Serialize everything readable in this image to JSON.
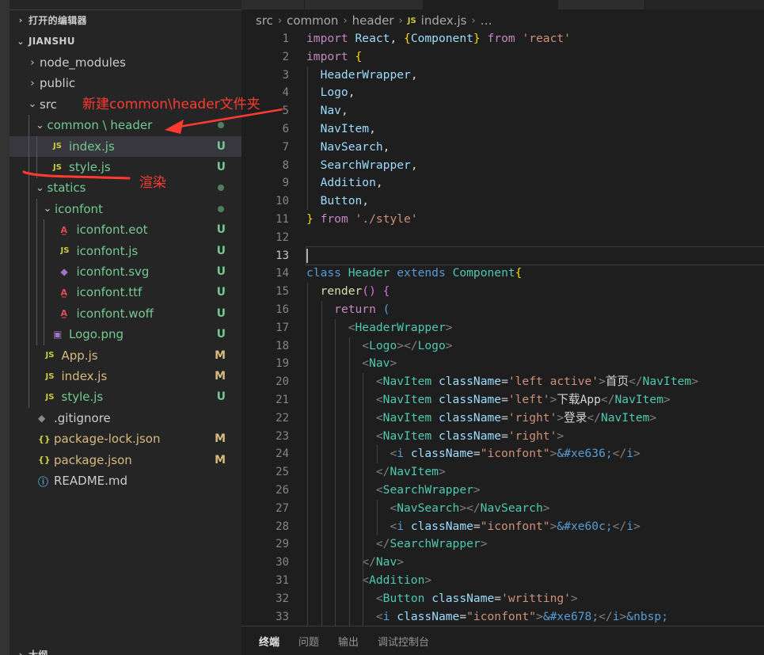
{
  "sidebar": {
    "open_editors_title": "打开的编辑器",
    "project_title": "JIANSHU",
    "outline_title": "大纲",
    "tree": [
      {
        "name": "node_modules",
        "depth": 0,
        "chevron": "›",
        "icon": "",
        "status": ""
      },
      {
        "name": "public",
        "depth": 0,
        "chevron": "›",
        "icon": "",
        "status": ""
      },
      {
        "name": "src",
        "depth": 0,
        "chevron": "⌄",
        "icon": "",
        "status": ""
      },
      {
        "name": "common \\ header",
        "depth": 1,
        "chevron": "⌄",
        "icon": "",
        "status": "dot"
      },
      {
        "name": "index.js",
        "depth": 2,
        "chevron": "",
        "icon": "JS",
        "status": "U",
        "selected": true
      },
      {
        "name": "style.js",
        "depth": 2,
        "chevron": "",
        "icon": "JS",
        "status": "U"
      },
      {
        "name": "statics",
        "depth": 1,
        "chevron": "⌄",
        "icon": "",
        "status": "dot"
      },
      {
        "name": "iconfont",
        "depth": 2,
        "chevron": "⌄",
        "icon": "",
        "status": "dot"
      },
      {
        "name": "iconfont.eot",
        "depth": 3,
        "chevron": "",
        "icon": "A",
        "status": "U"
      },
      {
        "name": "iconfont.js",
        "depth": 3,
        "chevron": "",
        "icon": "JS",
        "status": "U"
      },
      {
        "name": "iconfont.svg",
        "depth": 3,
        "chevron": "",
        "icon": "svg",
        "status": "U"
      },
      {
        "name": "iconfont.ttf",
        "depth": 3,
        "chevron": "",
        "icon": "A",
        "status": "U"
      },
      {
        "name": "iconfont.woff",
        "depth": 3,
        "chevron": "",
        "icon": "A",
        "status": "U"
      },
      {
        "name": "Logo.png",
        "depth": 2,
        "chevron": "",
        "icon": "img",
        "status": "U"
      },
      {
        "name": "App.js",
        "depth": 1,
        "chevron": "",
        "icon": "JS",
        "status": "M"
      },
      {
        "name": "index.js",
        "depth": 1,
        "chevron": "",
        "icon": "JS",
        "status": "M"
      },
      {
        "name": "style.js",
        "depth": 1,
        "chevron": "",
        "icon": "JS",
        "status": "U"
      },
      {
        "name": ".gitignore",
        "depth": 0,
        "chevron": "",
        "icon": "git",
        "status": ""
      },
      {
        "name": "package-lock.json",
        "depth": 0,
        "chevron": "",
        "icon": "{}",
        "status": "M"
      },
      {
        "name": "package.json",
        "depth": 0,
        "chevron": "",
        "icon": "{}",
        "status": "M"
      },
      {
        "name": "README.md",
        "depth": 0,
        "chevron": "",
        "icon": "info",
        "status": ""
      }
    ]
  },
  "editor": {
    "breadcrumb": [
      "src",
      "common",
      "header",
      "index.js",
      "…"
    ],
    "current_line": 13,
    "lines": [
      [
        [
          "kw",
          "import"
        ],
        [
          "tx",
          " "
        ],
        [
          "var",
          "React"
        ],
        [
          "tx",
          ", "
        ],
        [
          "br1",
          "{"
        ],
        [
          "var",
          "Component"
        ],
        [
          "br1",
          "}"
        ],
        [
          "tx",
          " "
        ],
        [
          "kw",
          "from"
        ],
        [
          "tx",
          " "
        ],
        [
          "str",
          "'react'"
        ]
      ],
      [
        [
          "kw",
          "import"
        ],
        [
          "tx",
          " "
        ],
        [
          "br1",
          "{"
        ]
      ],
      [
        [
          "tx",
          "  "
        ],
        [
          "var",
          "HeaderWrapper"
        ],
        [
          "tx",
          ","
        ]
      ],
      [
        [
          "tx",
          "  "
        ],
        [
          "var",
          "Logo"
        ],
        [
          "tx",
          ","
        ]
      ],
      [
        [
          "tx",
          "  "
        ],
        [
          "var",
          "Nav"
        ],
        [
          "tx",
          ","
        ]
      ],
      [
        [
          "tx",
          "  "
        ],
        [
          "var",
          "NavItem"
        ],
        [
          "tx",
          ","
        ]
      ],
      [
        [
          "tx",
          "  "
        ],
        [
          "var",
          "NavSearch"
        ],
        [
          "tx",
          ","
        ]
      ],
      [
        [
          "tx",
          "  "
        ],
        [
          "var",
          "SearchWrapper"
        ],
        [
          "tx",
          ","
        ]
      ],
      [
        [
          "tx",
          "  "
        ],
        [
          "var",
          "Addition"
        ],
        [
          "tx",
          ","
        ]
      ],
      [
        [
          "tx",
          "  "
        ],
        [
          "var",
          "Button"
        ],
        [
          "tx",
          ","
        ]
      ],
      [
        [
          "br1",
          "}"
        ],
        [
          "tx",
          " "
        ],
        [
          "kw",
          "from"
        ],
        [
          "tx",
          " "
        ],
        [
          "str",
          "'./style'"
        ]
      ],
      [],
      [],
      [
        [
          "kb",
          "class"
        ],
        [
          "tx",
          " "
        ],
        [
          "cls",
          "Header"
        ],
        [
          "tx",
          " "
        ],
        [
          "kb",
          "extends"
        ],
        [
          "tx",
          " "
        ],
        [
          "cls",
          "Component"
        ],
        [
          "br1",
          "{"
        ]
      ],
      [
        [
          "tx",
          "  "
        ],
        [
          "fn",
          "render"
        ],
        [
          "br2",
          "()"
        ],
        [
          "tx",
          " "
        ],
        [
          "br2",
          "{"
        ]
      ],
      [
        [
          "tx",
          "    "
        ],
        [
          "kw",
          "return"
        ],
        [
          "tx",
          " "
        ],
        [
          "kb",
          "("
        ]
      ],
      [
        [
          "tx",
          "      "
        ],
        [
          "tg",
          "<"
        ],
        [
          "tn",
          "HeaderWrapper"
        ],
        [
          "tg",
          ">"
        ]
      ],
      [
        [
          "tx",
          "        "
        ],
        [
          "tg",
          "<"
        ],
        [
          "tn",
          "Logo"
        ],
        [
          "tg",
          "></"
        ],
        [
          "tn",
          "Logo"
        ],
        [
          "tg",
          ">"
        ]
      ],
      [
        [
          "tx",
          "        "
        ],
        [
          "tg",
          "<"
        ],
        [
          "tn",
          "Nav"
        ],
        [
          "tg",
          ">"
        ]
      ],
      [
        [
          "tx",
          "          "
        ],
        [
          "tg",
          "<"
        ],
        [
          "tn",
          "NavItem"
        ],
        [
          "tx",
          " "
        ],
        [
          "at",
          "className"
        ],
        [
          "tx",
          "="
        ],
        [
          "str",
          "'left active'"
        ],
        [
          "tg",
          ">"
        ],
        [
          "tx",
          "首页"
        ],
        [
          "tg",
          "</"
        ],
        [
          "tn",
          "NavItem"
        ],
        [
          "tg",
          ">"
        ]
      ],
      [
        [
          "tx",
          "          "
        ],
        [
          "tg",
          "<"
        ],
        [
          "tn",
          "NavItem"
        ],
        [
          "tx",
          " "
        ],
        [
          "at",
          "className"
        ],
        [
          "tx",
          "="
        ],
        [
          "str",
          "'left'"
        ],
        [
          "tg",
          ">"
        ],
        [
          "tx",
          "下载App"
        ],
        [
          "tg",
          "</"
        ],
        [
          "tn",
          "NavItem"
        ],
        [
          "tg",
          ">"
        ]
      ],
      [
        [
          "tx",
          "          "
        ],
        [
          "tg",
          "<"
        ],
        [
          "tn",
          "NavItem"
        ],
        [
          "tx",
          " "
        ],
        [
          "at",
          "className"
        ],
        [
          "tx",
          "="
        ],
        [
          "str",
          "'right'"
        ],
        [
          "tg",
          ">"
        ],
        [
          "tx",
          "登录"
        ],
        [
          "tg",
          "</"
        ],
        [
          "tn",
          "NavItem"
        ],
        [
          "tg",
          ">"
        ]
      ],
      [
        [
          "tx",
          "          "
        ],
        [
          "tg",
          "<"
        ],
        [
          "tn",
          "NavItem"
        ],
        [
          "tx",
          " "
        ],
        [
          "at",
          "className"
        ],
        [
          "tx",
          "="
        ],
        [
          "str",
          "'right'"
        ],
        [
          "tg",
          ">"
        ]
      ],
      [
        [
          "tx",
          "            "
        ],
        [
          "tg",
          "<"
        ],
        [
          "kb",
          "i"
        ],
        [
          "tx",
          " "
        ],
        [
          "at",
          "className"
        ],
        [
          "tx",
          "="
        ],
        [
          "str",
          "\"iconfont\""
        ],
        [
          "tg",
          ">"
        ],
        [
          "kb",
          "&#xe636;"
        ],
        [
          "tg",
          "</"
        ],
        [
          "kb",
          "i"
        ],
        [
          "tg",
          ">"
        ]
      ],
      [
        [
          "tx",
          "          "
        ],
        [
          "tg",
          "</"
        ],
        [
          "tn",
          "NavItem"
        ],
        [
          "tg",
          ">"
        ]
      ],
      [
        [
          "tx",
          "          "
        ],
        [
          "tg",
          "<"
        ],
        [
          "tn",
          "SearchWrapper"
        ],
        [
          "tg",
          ">"
        ]
      ],
      [
        [
          "tx",
          "            "
        ],
        [
          "tg",
          "<"
        ],
        [
          "tn",
          "NavSearch"
        ],
        [
          "tg",
          "></"
        ],
        [
          "tn",
          "NavSearch"
        ],
        [
          "tg",
          ">"
        ]
      ],
      [
        [
          "tx",
          "            "
        ],
        [
          "tg",
          "<"
        ],
        [
          "kb",
          "i"
        ],
        [
          "tx",
          " "
        ],
        [
          "at",
          "className"
        ],
        [
          "tx",
          "="
        ],
        [
          "str",
          "\"iconfont\""
        ],
        [
          "tg",
          ">"
        ],
        [
          "kb",
          "&#xe60c;"
        ],
        [
          "tg",
          "</"
        ],
        [
          "kb",
          "i"
        ],
        [
          "tg",
          ">"
        ]
      ],
      [
        [
          "tx",
          "          "
        ],
        [
          "tg",
          "</"
        ],
        [
          "tn",
          "SearchWrapper"
        ],
        [
          "tg",
          ">"
        ]
      ],
      [
        [
          "tx",
          "        "
        ],
        [
          "tg",
          "</"
        ],
        [
          "tn",
          "Nav"
        ],
        [
          "tg",
          ">"
        ]
      ],
      [
        [
          "tx",
          "        "
        ],
        [
          "tg",
          "<"
        ],
        [
          "tn",
          "Addition"
        ],
        [
          "tg",
          ">"
        ]
      ],
      [
        [
          "tx",
          "          "
        ],
        [
          "tg",
          "<"
        ],
        [
          "tn",
          "Button"
        ],
        [
          "tx",
          " "
        ],
        [
          "at",
          "className"
        ],
        [
          "tx",
          "="
        ],
        [
          "str",
          "'writting'"
        ],
        [
          "tg",
          ">"
        ]
      ],
      [
        [
          "tx",
          "          "
        ],
        [
          "tg",
          "<"
        ],
        [
          "kb",
          "i"
        ],
        [
          "tx",
          " "
        ],
        [
          "at",
          "className"
        ],
        [
          "tx",
          "="
        ],
        [
          "str",
          "\"iconfont\""
        ],
        [
          "tg",
          ">"
        ],
        [
          "kb",
          "&#xe678;"
        ],
        [
          "tg",
          "</"
        ],
        [
          "kb",
          "i"
        ],
        [
          "tg",
          ">"
        ],
        [
          "kb",
          "&nbsp;"
        ]
      ]
    ]
  },
  "panel": {
    "tabs": [
      "终端",
      "问题",
      "输出",
      "调试控制台"
    ],
    "active": 0
  },
  "annotations": {
    "new_folder": "新建common\\header文件夹",
    "render": "渲染"
  },
  "colors": {
    "annotation": "#ff3b30",
    "untracked": "#73c991",
    "modified": "#d7ba7d"
  }
}
